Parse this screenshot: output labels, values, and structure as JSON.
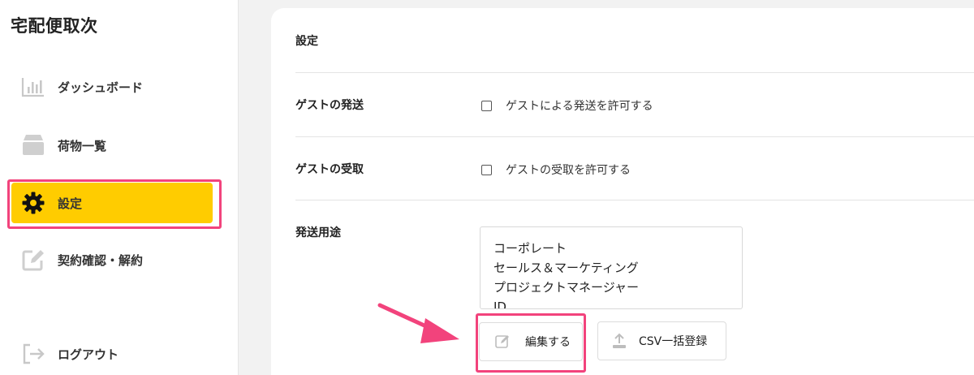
{
  "app": {
    "title": "宅配便取次"
  },
  "sidebar": {
    "items": [
      {
        "label": "ダッシュボード",
        "icon": "bar-chart-icon"
      },
      {
        "label": "荷物一覧",
        "icon": "box-icon"
      },
      {
        "label": "設定",
        "icon": "gear-icon",
        "active": true
      },
      {
        "label": "契約確認・解約",
        "icon": "edit-icon"
      }
    ],
    "logout": {
      "label": "ログアウト",
      "icon": "logout-icon"
    }
  },
  "settings": {
    "heading": "設定",
    "guest_send": {
      "label": "ゲストの発送",
      "checkbox_label": "ゲストによる発送を許可する",
      "checked": false
    },
    "guest_receive": {
      "label": "ゲストの受取",
      "checkbox_label": "ゲストの受取を許可する",
      "checked": false
    },
    "purpose": {
      "label": "発送用途",
      "options": [
        "コーポレート",
        "セールス＆マーケティング",
        "プロジェクトマネージャー",
        "ID"
      ]
    },
    "edit_button": {
      "label": "編集する",
      "icon": "edit-icon"
    },
    "csv_button": {
      "label": "CSV一括登録",
      "icon": "upload-icon"
    }
  },
  "colors": {
    "accent": "#ffcc00",
    "highlight": "#f2437c",
    "icon_gray": "#cfcfcf"
  }
}
